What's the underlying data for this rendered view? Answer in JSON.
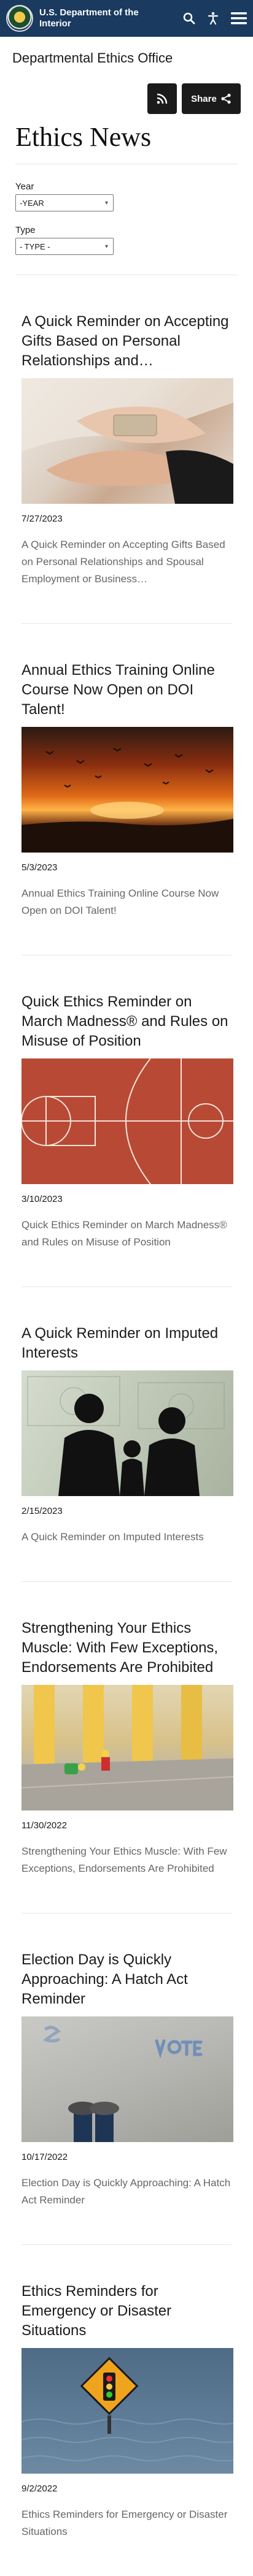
{
  "header": {
    "agency": "U.S. Department of the Interior",
    "icons": [
      "search-icon",
      "accessibility-icon",
      "menu-icon"
    ]
  },
  "office_title": "Departmental Ethics Office",
  "actions": {
    "share_label": "Share"
  },
  "page_title": "Ethics News",
  "filters": {
    "year_label": "Year",
    "year_value": "-YEAR",
    "type_label": "Type",
    "type_value": "- TYPE -"
  },
  "articles": [
    {
      "title": "A Quick Reminder on Accepting Gifts Based on Personal Relationships and…",
      "date": "7/27/2023",
      "summary": "A Quick Reminder on Accepting Gifts Based on Personal Relationships and Spousal Employment or Business…"
    },
    {
      "title": "Annual Ethics Training Online Course Now Open on DOI Talent!",
      "date": "5/3/2023",
      "summary": "Annual Ethics Training Online Course Now Open on DOI Talent!"
    },
    {
      "title": "Quick Ethics Reminder on March Madness® and Rules on Misuse of Position",
      "date": "3/10/2023",
      "summary": "Quick Ethics Reminder on March Madness® and Rules on Misuse of Position"
    },
    {
      "title": "A Quick Reminder on Imputed Interests",
      "date": "2/15/2023",
      "summary": "A Quick Reminder on Imputed Interests"
    },
    {
      "title": "Strengthening Your Ethics Muscle: With Few Exceptions, Endorsements Are Prohibited",
      "date": "11/30/2022",
      "summary": "Strengthening Your Ethics Muscle: With Few Exceptions, Endorsements Are Prohibited"
    },
    {
      "title": "Election Day is Quickly Approaching: A Hatch Act Reminder",
      "date": "10/17/2022",
      "summary": "Election Day is Quickly Approaching: A Hatch Act Reminder"
    },
    {
      "title": "Ethics Reminders for Emergency or Disaster Situations",
      "date": "9/2/2022",
      "summary": "Ethics Reminders for Emergency or Disaster Situations"
    }
  ],
  "colors": {
    "header_bg": "#1a3a5f",
    "button_dark": "#1b1b1b",
    "summary_text": "#666666"
  }
}
